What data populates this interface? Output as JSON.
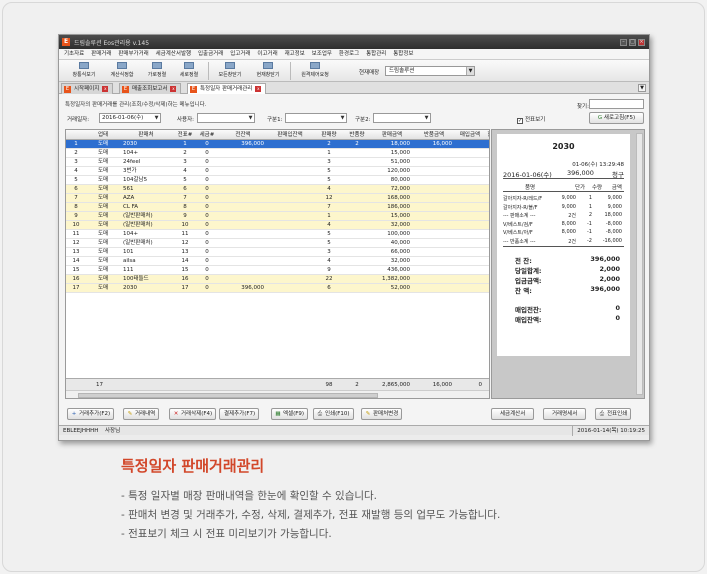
{
  "window": {
    "title": "드림솔루션 Eos관리용 v.145",
    "logo": "E"
  },
  "menu": [
    "기초자료",
    "판매거래",
    "판매부가거래",
    "세금계산서발행",
    "입출금거래",
    "입고거래",
    "이고거래",
    "재고정보",
    "보조업무",
    "환경로그",
    "통합관리",
    "통합정보"
  ],
  "toolbar": {
    "buttons": [
      "창통식보기",
      "계산식정합",
      "가로정렬",
      "세로정렬",
      "모든창닫기",
      "현재창닫기",
      "원격제어요청"
    ],
    "shop_label": "현재매장",
    "shop_value": "드림솔루션"
  },
  "tabs": [
    "시작페이지",
    "매출조회보고서",
    "특정일자 판매거래관리"
  ],
  "panel": {
    "description": "특정일자의 판매거래를 관리(조회/수정/삭제)하는 메뉴입니다.",
    "date_label": "거래일자:",
    "date_value": "2016-01-06(수)",
    "user_label": "사용자:",
    "cat1_label": "구분1:",
    "cat2_label": "구분2:",
    "search_label": "찾기:",
    "preview_label": "전표보기",
    "refresh_label": "새로고침(F5)"
  },
  "grid": {
    "headers": [
      "업태",
      "판매처",
      "전표#",
      "세금#",
      "전잔액",
      "판매입잔액",
      "판매량",
      "반품량",
      "판매금액",
      "반품금액",
      "매입금액",
      "할"
    ],
    "rows": [
      {
        "no": "1",
        "type": "도매",
        "name": "2030",
        "slip": "1",
        "tax": "0",
        "prev": "396,000",
        "qty": "2",
        "ret": "2",
        "sale": "18,000",
        "retamt": "16,000"
      },
      {
        "no": "2",
        "type": "도매",
        "name": "104+",
        "slip": "2",
        "tax": "0",
        "prev": "",
        "qty": "1",
        "ret": "",
        "sale": "15,000",
        "retamt": ""
      },
      {
        "no": "3",
        "type": "도매",
        "name": "24feel",
        "slip": "3",
        "tax": "0",
        "prev": "",
        "qty": "3",
        "ret": "",
        "sale": "51,000",
        "retamt": ""
      },
      {
        "no": "4",
        "type": "도매",
        "name": "3번가",
        "slip": "4",
        "tax": "0",
        "prev": "",
        "qty": "5",
        "ret": "",
        "sale": "120,000",
        "retamt": ""
      },
      {
        "no": "5",
        "type": "도매",
        "name": "104갈남5",
        "slip": "5",
        "tax": "0",
        "prev": "",
        "qty": "5",
        "ret": "",
        "sale": "80,000",
        "retamt": ""
      },
      {
        "no": "6",
        "type": "도매",
        "name": "561",
        "slip": "6",
        "tax": "0",
        "prev": "",
        "qty": "4",
        "ret": "",
        "sale": "72,000",
        "retamt": ""
      },
      {
        "no": "7",
        "type": "도매",
        "name": "AZA",
        "slip": "7",
        "tax": "0",
        "prev": "",
        "qty": "12",
        "ret": "",
        "sale": "168,000",
        "retamt": ""
      },
      {
        "no": "8",
        "type": "도매",
        "name": "CL FA",
        "slip": "8",
        "tax": "0",
        "prev": "",
        "qty": "7",
        "ret": "",
        "sale": "186,000",
        "retamt": ""
      },
      {
        "no": "9",
        "type": "도매",
        "name": "(일반판매처)",
        "slip": "9",
        "tax": "0",
        "prev": "",
        "qty": "1",
        "ret": "",
        "sale": "15,000",
        "retamt": ""
      },
      {
        "no": "10",
        "type": "도매",
        "name": "(일반판매처)",
        "slip": "10",
        "tax": "0",
        "prev": "",
        "qty": "4",
        "ret": "",
        "sale": "32,000",
        "retamt": ""
      },
      {
        "no": "11",
        "type": "도매",
        "name": "104+",
        "slip": "11",
        "tax": "0",
        "prev": "",
        "qty": "5",
        "ret": "",
        "sale": "100,000",
        "retamt": ""
      },
      {
        "no": "12",
        "type": "도매",
        "name": "(일반판매처)",
        "slip": "12",
        "tax": "0",
        "prev": "",
        "qty": "5",
        "ret": "",
        "sale": "40,000",
        "retamt": ""
      },
      {
        "no": "13",
        "type": "도매",
        "name": "101",
        "slip": "13",
        "tax": "0",
        "prev": "",
        "qty": "3",
        "ret": "",
        "sale": "66,000",
        "retamt": ""
      },
      {
        "no": "14",
        "type": "도매",
        "name": "ailsa",
        "slip": "14",
        "tax": "0",
        "prev": "",
        "qty": "4",
        "ret": "",
        "sale": "32,000",
        "retamt": ""
      },
      {
        "no": "15",
        "type": "도매",
        "name": "111",
        "slip": "15",
        "tax": "0",
        "prev": "",
        "qty": "9",
        "ret": "",
        "sale": "436,000",
        "retamt": ""
      },
      {
        "no": "16",
        "type": "도매",
        "name": "100태들드",
        "slip": "16",
        "tax": "0",
        "prev": "",
        "qty": "22",
        "ret": "",
        "sale": "1,382,000",
        "retamt": ""
      },
      {
        "no": "17",
        "type": "도매",
        "name": "2030",
        "slip": "17",
        "tax": "0",
        "prev": "396,000",
        "qty": "6",
        "ret": "",
        "sale": "52,000",
        "retamt": ""
      }
    ],
    "footer": {
      "count": "17",
      "qty": "98",
      "ret": "2",
      "sale": "2,865,000",
      "retamt": "16,000",
      "buy": "0"
    }
  },
  "receipt": {
    "title": "2030",
    "timestamp": "01-06(수) 13:29:48",
    "date": "2016-01-06(수)",
    "amount": "396,000",
    "status": "청구",
    "col_item": "품명",
    "col_price": "단가",
    "col_qty": "수량",
    "col_amount": "금액",
    "items": [
      {
        "name": "갈아지자-R/레드/F",
        "price": "9,000",
        "qty": "1",
        "amount": "9,000"
      },
      {
        "name": "갈아지자-R/블/F",
        "price": "9,000",
        "qty": "1",
        "amount": "9,000"
      },
      {
        "name": "--- 판매소계 ---",
        "price": "2건",
        "qty": "2",
        "amount": "18,000"
      },
      {
        "name": "V/베스트/검/F",
        "price": "8,000",
        "qty": "-1",
        "amount": "-8,000"
      },
      {
        "name": "V/베스트/아/F",
        "price": "8,000",
        "qty": "-1",
        "amount": "-8,000"
      },
      {
        "name": "--- 반품소계 ---",
        "price": "2건",
        "qty": "-2",
        "amount": "-16,000"
      }
    ],
    "summary": [
      {
        "label": "전     잔:",
        "value": "396,000"
      },
      {
        "label": "당일합계:",
        "value": "2,000"
      },
      {
        "label": "입금금액:",
        "value": "2,000"
      },
      {
        "label": "잔     액:",
        "value": "396,000"
      }
    ],
    "buy_summary": [
      {
        "label": "매입전잔:",
        "value": "0"
      },
      {
        "label": "매입잔액:",
        "value": "0"
      }
    ]
  },
  "actions": {
    "left": [
      "거래추가(F2)",
      "거래내역",
      "거래삭제(F4)",
      "결제추가(F7)",
      "엑셀(F9)",
      "인쇄(F10)",
      "판매처변경"
    ],
    "right": [
      "세금계산서",
      "거래명세서",
      "전표인쇄"
    ]
  },
  "status": {
    "user_id": "EBLEEJHHHH",
    "user_name": "사장님",
    "clock": "2016-01-14(목) 10:19:25"
  },
  "caption": {
    "title": "특정일자 판매거래관리",
    "lines": [
      "- 특정 일자별 매장 판매내역을 한눈에 확인할 수 있습니다.",
      "- 판매처 변경 및 거래추가, 수정, 삭제, 결제추가, 전표 재발행 등의 업무도 가능합니다.",
      "- 전표보기 체크 시 전표 미리보기가 가능합니다."
    ]
  }
}
